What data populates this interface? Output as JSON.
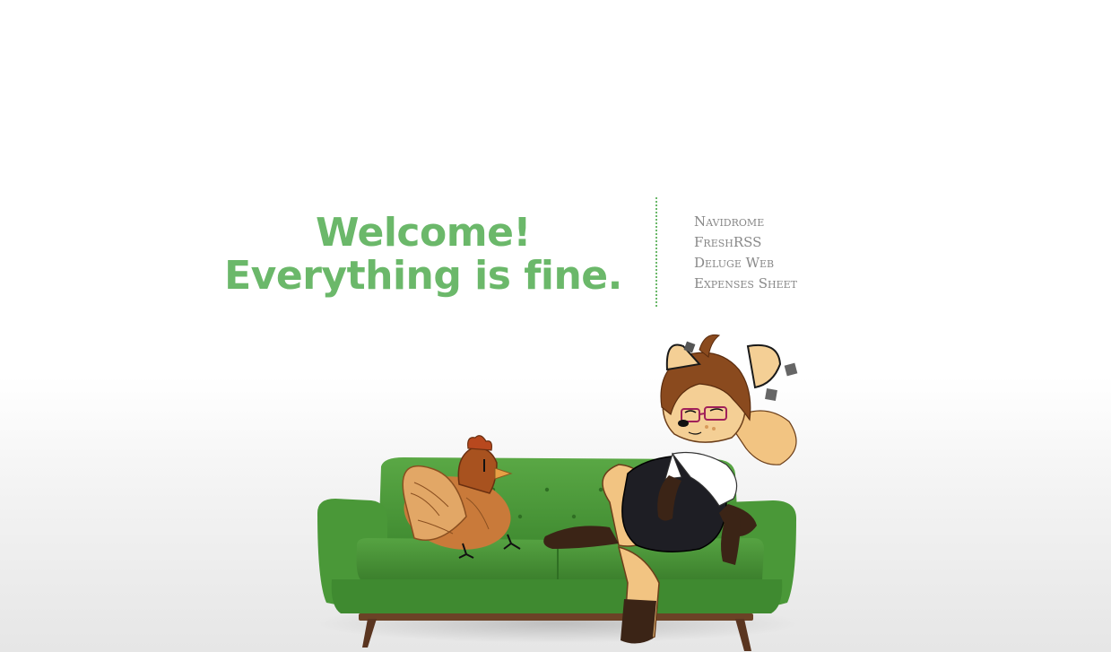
{
  "hero": {
    "line1": "Welcome!",
    "line2": "Everything is fine."
  },
  "links": [
    {
      "label": "Navidrome"
    },
    {
      "label": "FreshRSS"
    },
    {
      "label": "Deluge Web"
    },
    {
      "label": "Expenses Sheet"
    }
  ],
  "colors": {
    "accent": "#6bb86a",
    "link": "#888888",
    "sofa": "#4f9a3c"
  }
}
